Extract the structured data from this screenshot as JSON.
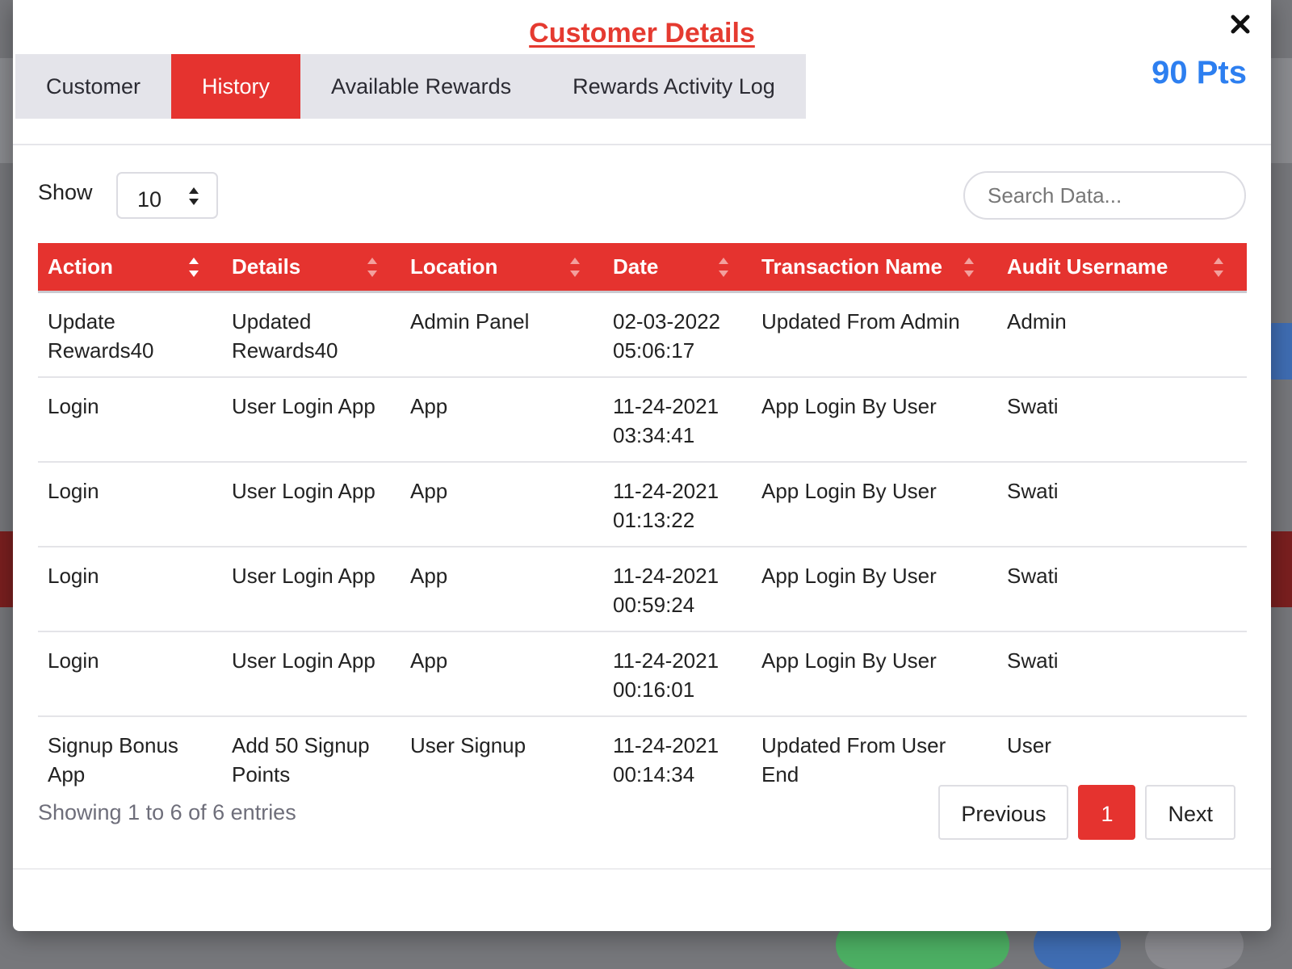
{
  "modal": {
    "title": "Customer Details",
    "points": "90 Pts",
    "tabs": [
      {
        "label": "Customer",
        "active": false
      },
      {
        "label": "History",
        "active": true
      },
      {
        "label": "Available Rewards",
        "active": false
      },
      {
        "label": "Rewards Activity Log",
        "active": false
      }
    ]
  },
  "controls": {
    "show_label": "Show",
    "page_length": "10",
    "search_placeholder": "Search Data..."
  },
  "table": {
    "columns": [
      "Action",
      "Details",
      "Location",
      "Date",
      "Transaction Name",
      "Audit Username"
    ],
    "rows": [
      {
        "action": "Update Rewards40",
        "details": "Updated Rewards40",
        "location": "Admin Panel",
        "date": "02-03-2022 05:06:17",
        "transaction": "Updated From Admin",
        "user": "Admin"
      },
      {
        "action": "Login",
        "details": "User Login App",
        "location": "App",
        "date": "11-24-2021 03:34:41",
        "transaction": "App Login By User",
        "user": "Swati"
      },
      {
        "action": "Login",
        "details": "User Login App",
        "location": "App",
        "date": "11-24-2021 01:13:22",
        "transaction": "App Login By User",
        "user": "Swati"
      },
      {
        "action": "Login",
        "details": "User Login App",
        "location": "App",
        "date": "11-24-2021 00:59:24",
        "transaction": "App Login By User",
        "user": "Swati"
      },
      {
        "action": "Login",
        "details": "User Login App",
        "location": "App",
        "date": "11-24-2021 00:16:01",
        "transaction": "App Login By User",
        "user": "Swati"
      },
      {
        "action": "Signup Bonus App",
        "details": "Add 50 Signup Points",
        "location": "User Signup",
        "date": "11-24-2021 00:14:34",
        "transaction": "Updated From User End",
        "user": "User"
      }
    ]
  },
  "footer": {
    "info": "Showing 1 to 6 of 6 entries",
    "previous_label": "Previous",
    "current_page": "1",
    "next_label": "Next"
  },
  "colors": {
    "accent": "#e5332f",
    "points": "#2d7ff0",
    "tab_bar": "#e4e4ea"
  }
}
